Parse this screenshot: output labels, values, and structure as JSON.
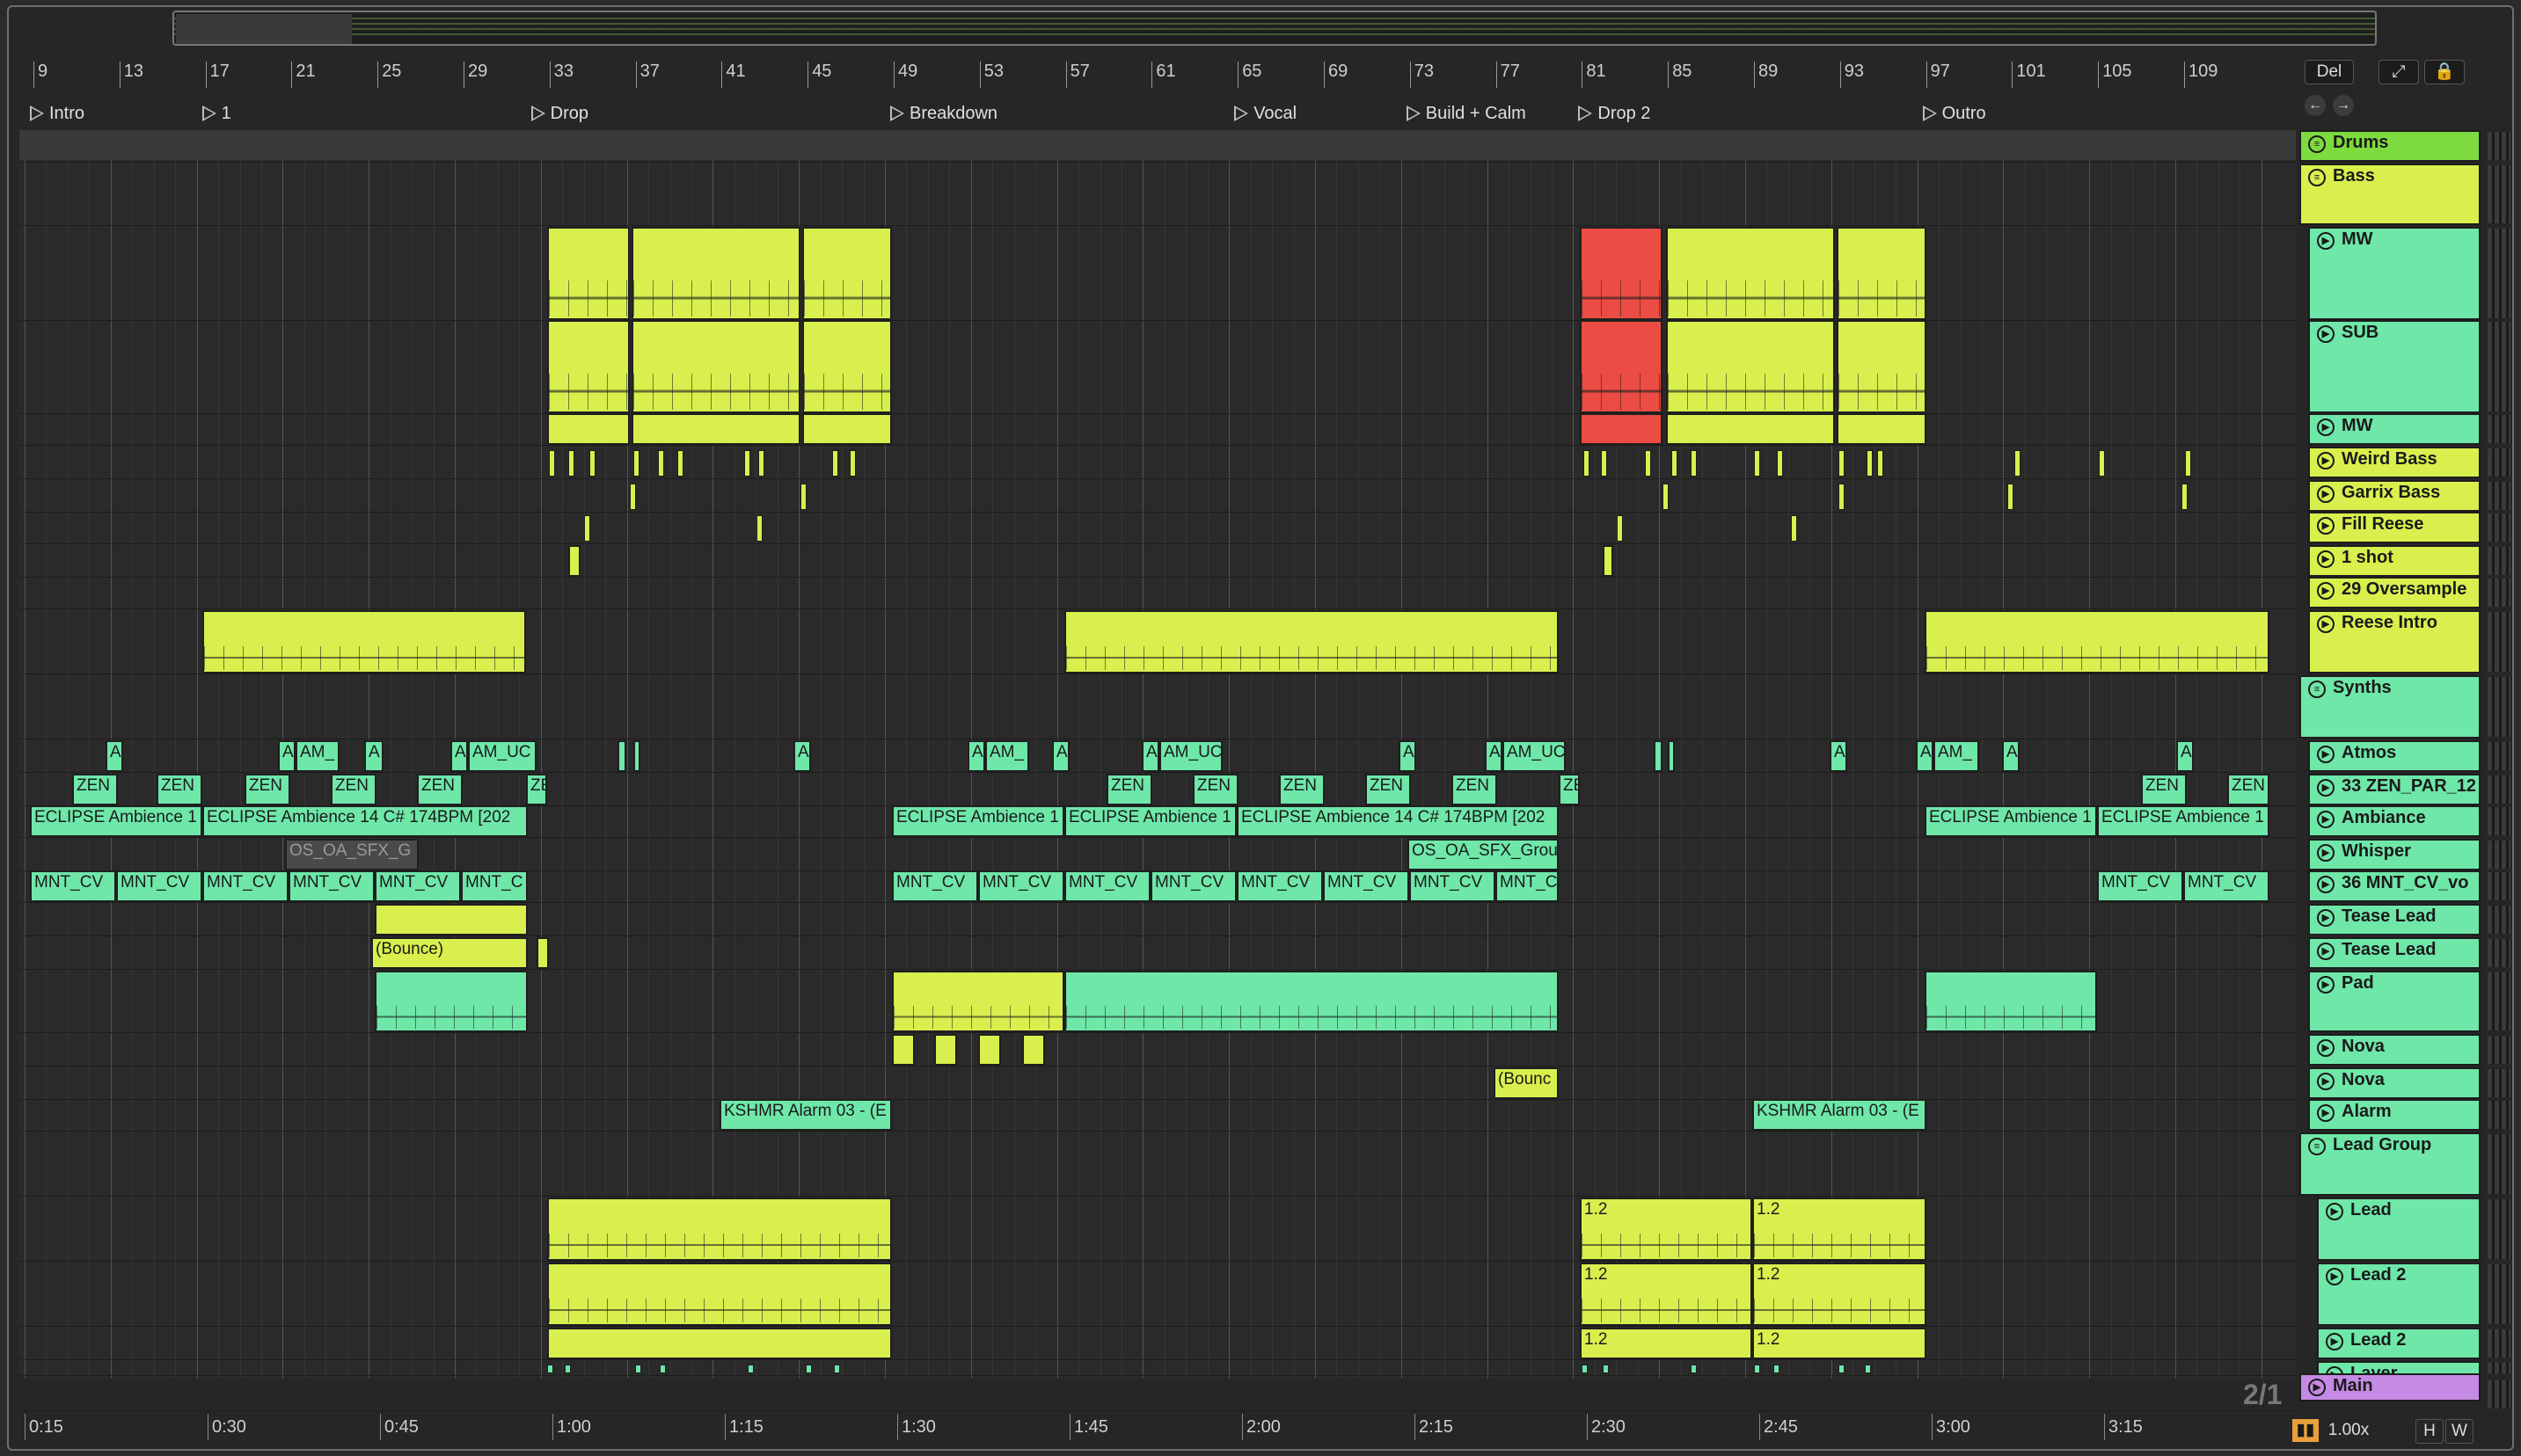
{
  "ruler": {
    "bars": [
      "9",
      "13",
      "17",
      "21",
      "25",
      "29",
      "33",
      "37",
      "41",
      "45",
      "49",
      "53",
      "57",
      "61",
      "65",
      "69",
      "73",
      "77",
      "81",
      "85",
      "89",
      "93",
      "97",
      "101",
      "105",
      "109"
    ]
  },
  "locators": [
    "Intro",
    "1",
    "Drop",
    "Breakdown",
    "Vocal",
    "Build + Calm",
    "Drop 2",
    "Outro"
  ],
  "time": [
    "0:15",
    "0:30",
    "0:45",
    "1:00",
    "1:15",
    "1:30",
    "1:45",
    "2:00",
    "2:15",
    "2:30",
    "2:45",
    "3:00",
    "3:15"
  ],
  "top_controls": {
    "del": "Del",
    "expand_icon": "expand-icon",
    "lock_icon": "lock-icon"
  },
  "tracks": [
    {
      "name": "Drums",
      "color": "#7edb3f"
    },
    {
      "name": "Bass",
      "color": "#d8ef4d"
    },
    {
      "name": "MW",
      "color": "#6ee7a9"
    },
    {
      "name": "SUB",
      "color": "#6ee7a9"
    },
    {
      "name": "MW",
      "color": "#6ee7a9"
    },
    {
      "name": "Weird Bass",
      "color": "#d8ef4d"
    },
    {
      "name": "Garrix Bass",
      "color": "#d8ef4d"
    },
    {
      "name": "Fill Reese",
      "color": "#d8ef4d"
    },
    {
      "name": "1 shot",
      "color": "#d8ef4d"
    },
    {
      "name": "29 Oversample",
      "color": "#d8ef4d"
    },
    {
      "name": "Reese Intro",
      "color": "#d8ef4d"
    },
    {
      "name": "Synths",
      "color": "#6ee7a9"
    },
    {
      "name": "Atmos",
      "color": "#6ee7a9"
    },
    {
      "name": "33 ZEN_PAR_12",
      "color": "#6ee7a9"
    },
    {
      "name": "Ambiance",
      "color": "#6ee7a9"
    },
    {
      "name": "Whisper",
      "color": "#6ee7a9"
    },
    {
      "name": "36 MNT_CV_vo",
      "color": "#6ee7a9"
    },
    {
      "name": "Tease Lead",
      "color": "#6ee7a9"
    },
    {
      "name": "Tease Lead",
      "color": "#6ee7a9"
    },
    {
      "name": "Pad",
      "color": "#6ee7a9"
    },
    {
      "name": "Nova",
      "color": "#6ee7a9"
    },
    {
      "name": "Nova",
      "color": "#6ee7a9"
    },
    {
      "name": "Alarm",
      "color": "#6ee7a9"
    },
    {
      "name": "Lead Group",
      "color": "#6ee7a9"
    },
    {
      "name": "Lead",
      "color": "#6ee7a9"
    },
    {
      "name": "Lead 2",
      "color": "#6ee7a9"
    },
    {
      "name": "Lead 2",
      "color": "#6ee7a9"
    },
    {
      "name": "Layer",
      "color": "#6ee7a9"
    },
    {
      "name": "Main",
      "color": "#c58ae3"
    }
  ],
  "clips": {
    "ambience": "ECLIPSE Ambience 14 C# 174BPM [202",
    "ambience_short": "ECLIPSE Ambience 1",
    "zen": "ZEN",
    "mnt": "MNT_CV",
    "mnt_short": "MNT_C",
    "am": "AM_",
    "am_uc": "AM_UC",
    "a": "A",
    "os_sfx": "OS_OA_SFX_G",
    "os_sfx2": "OS_OA_SFX_Grou",
    "bounce": "(Bounce)",
    "bounce_short": "(Bounc",
    "alarm": "KSHMR Alarm 03 - (E",
    "lead_val": "1.2"
  },
  "page_indicator": "2/1",
  "zoom": "1.00x",
  "view_buttons": {
    "h": "H",
    "w": "W"
  }
}
